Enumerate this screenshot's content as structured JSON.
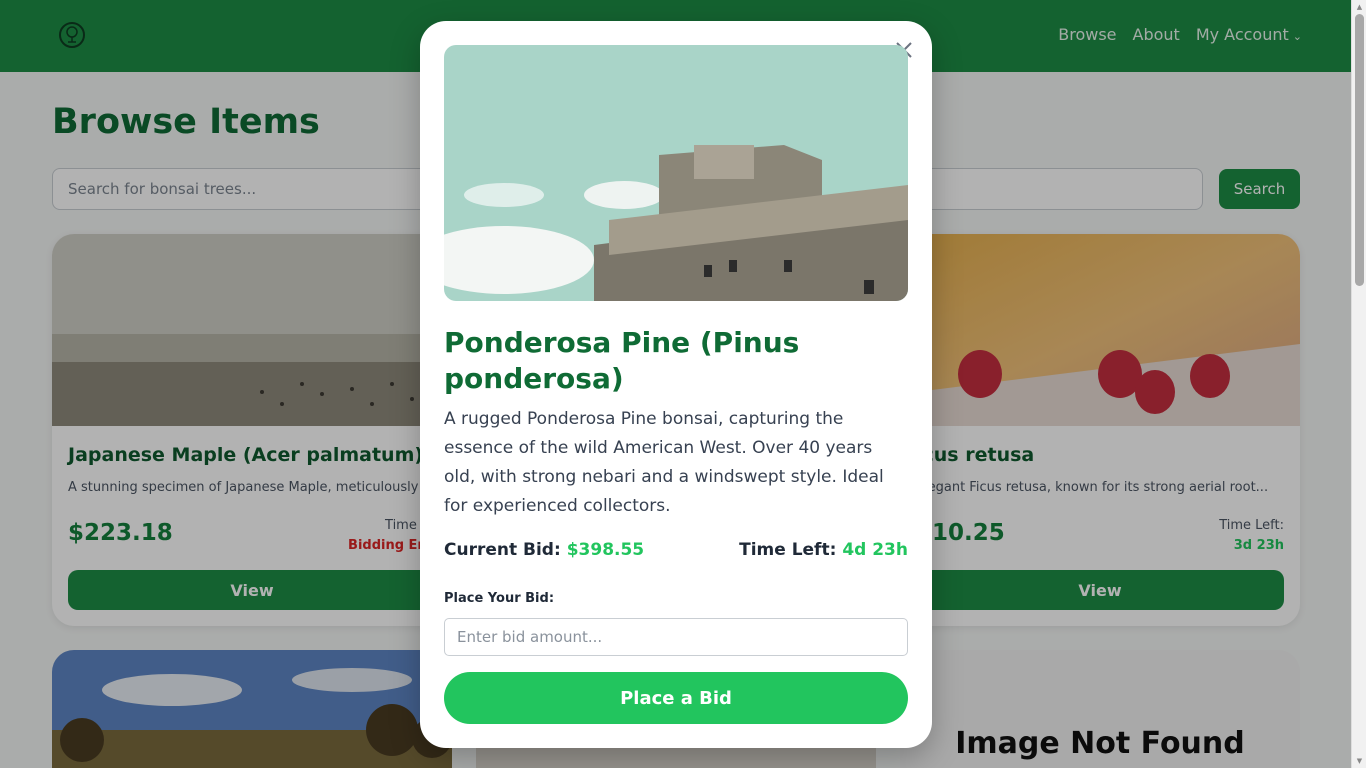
{
  "header": {
    "logo_icon": "bonsai-tree-icon",
    "nav": [
      "Browse",
      "About",
      "My Account"
    ]
  },
  "page": {
    "title": "Browse Items",
    "search_placeholder": "Search for bonsai trees...",
    "search_button": "Search"
  },
  "cards": [
    {
      "title": "Japanese Maple (Acer palmatum)",
      "description": "A stunning specimen of Japanese Maple, meticulously t",
      "price": "$223.18",
      "time_label": "Time Le",
      "time_value": "Bidding End",
      "time_color": "#dc2626",
      "view_label": "View"
    },
    {
      "title": "icus retusa",
      "description": "elegant Ficus retusa, known for its strong aerial root...",
      "price": "110.25",
      "time_label": "Time Left:",
      "time_value": "3d 23h",
      "time_color": "#22c55e",
      "view_label": "View"
    }
  ],
  "bottom_cards": {
    "image_not_found": "Image Not Found"
  },
  "modal": {
    "title": "Ponderosa Pine (Pinus ponderosa)",
    "description": "A rugged Ponderosa Pine bonsai, capturing the essence of the wild American West. Over 40 years old, with strong nebari and a windswept style. Ideal for experienced collectors.",
    "current_bid_label": "Current Bid:",
    "current_bid_value": "$398.55",
    "time_left_label": "Time Left:",
    "time_left_value": "4d 23h",
    "bid_label": "Place Your Bid:",
    "bid_placeholder": "Enter bid amount...",
    "bid_button": "Place a Bid",
    "close_icon": "close-icon"
  },
  "colors": {
    "brand_green": "#1d8d46",
    "accent_green": "#22c55e",
    "title_green": "#0f6b35",
    "error_red": "#dc2626"
  }
}
